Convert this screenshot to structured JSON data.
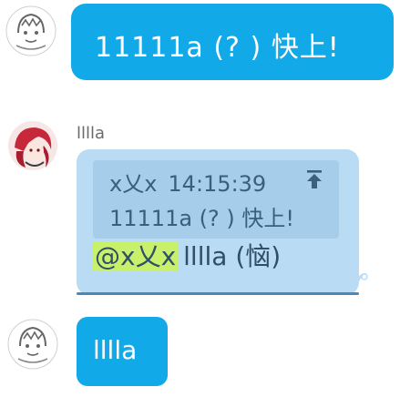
{
  "messages": [
    {
      "text": "11111a (? ) 快上!"
    },
    {
      "sender_name": "lllla",
      "quote": {
        "author": "x乂x",
        "time": "14:15:39",
        "text": "11111a (? ) 快上!",
        "jump_icon": "arrow-to-top-icon"
      },
      "mention": "@x乂x",
      "body": "lllla (恼)"
    },
    {
      "text": "lllla"
    }
  ],
  "colors": {
    "self_bubble": "#12a9e8",
    "reply_bubble": "#b9dbf4",
    "quote_bg": "#a6cdea",
    "mention_highlight": "#c9f06b"
  },
  "icons": {
    "self_avatar": "sketch-character-avatar",
    "other_avatar": "red-hair-anime-avatar"
  }
}
